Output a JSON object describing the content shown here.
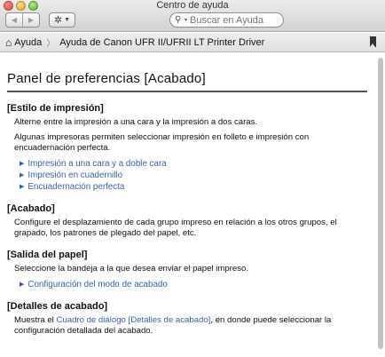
{
  "window": {
    "title": "Centro de ayuda"
  },
  "toolbar": {
    "back_icon": "back-arrow-icon",
    "forward_icon": "forward-arrow-icon",
    "gear_icon": "gear-icon",
    "search_placeholder": "Buscar en Ayuda"
  },
  "breadcrumb": {
    "home_label": "Ayuda",
    "current_label": "Ayuda de Canon UFR II/UFRII LT Printer Driver"
  },
  "page": {
    "title": "Panel de preferencias [Acabado]",
    "sections": [
      {
        "heading": "[Estilo de impresión]",
        "paragraphs": [
          "Alterne entre la impresión a una cara y la impresión a dos caras.",
          "Algunas impresoras permiten seleccionar impresión en folleto e impresión con encuadernación perfecta."
        ],
        "links": [
          "Impresión a una cara y a doble cara",
          "Impresión en cuadernillo",
          "Encuadernación perfecta"
        ]
      },
      {
        "heading": "[Acabado]",
        "paragraphs": [
          "Configure el desplazamiento de cada grupo impreso en relación a los otros grupos, el grapado, los patrones de plegado del papel, etc."
        ]
      },
      {
        "heading": "[Salida del papel]",
        "paragraphs": [
          "Seleccione la bandeja a la que desea enviar el papel impreso."
        ],
        "links": [
          "Configuración del modo de acabado"
        ]
      },
      {
        "heading": "[Detalles de acabado]",
        "text_before": "Muestra el ",
        "link": "Cuadro de diálogo [Detalles de acabado]",
        "text_after": ", en donde puede seleccionar la configuración detallada del acabado."
      }
    ]
  },
  "colors": {
    "link": "#3a5fb5",
    "toolbar_top": "#ececec",
    "toolbar_bottom": "#d2d2d2"
  }
}
